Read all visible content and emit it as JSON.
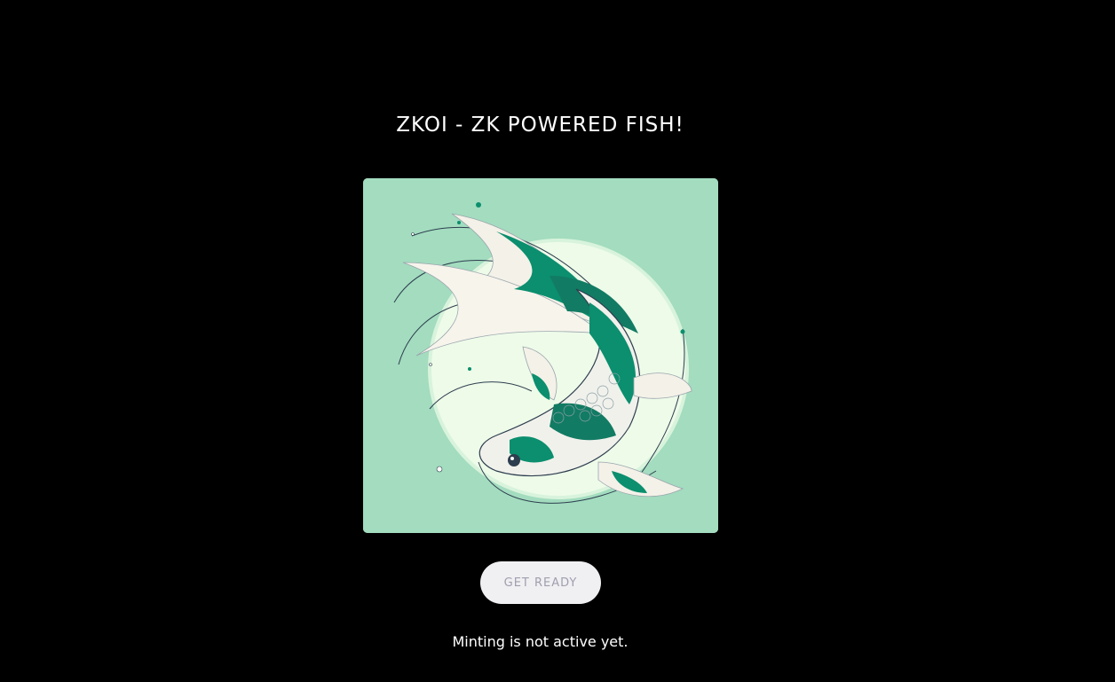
{
  "page": {
    "title": "ZKOI - ZK POWERED FISH!"
  },
  "artwork": {
    "subject": "koi-fish-illustration",
    "background_color": "#a3dcbf",
    "accent_color": "#0b8f6e"
  },
  "mint": {
    "button_label": "GET READY",
    "button_state": "disabled",
    "status_message": "Minting is not active yet."
  },
  "colors": {
    "page_background": "#000000",
    "button_background": "#f0f0f3",
    "button_text": "#9f9fae"
  }
}
